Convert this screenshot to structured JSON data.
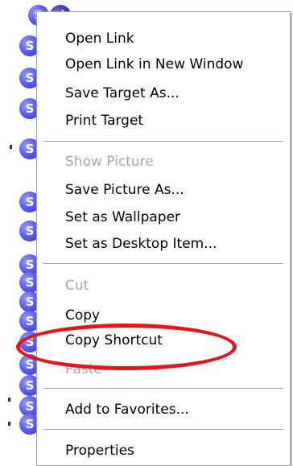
{
  "background": {
    "icons": [
      {
        "letter": "S"
      },
      {
        "letter": "d"
      },
      {
        "letter": "S"
      },
      {
        "letter": "S"
      },
      {
        "letter": "S"
      },
      {
        "letter": "S"
      },
      {
        "letter": "S"
      },
      {
        "letter": "S"
      },
      {
        "letter": "S"
      },
      {
        "letter": "S"
      },
      {
        "letter": "S"
      },
      {
        "letter": "S"
      },
      {
        "letter": "S"
      },
      {
        "letter": "S"
      },
      {
        "letter": "S"
      },
      {
        "letter": "S"
      },
      {
        "letter": "S"
      },
      {
        "letter": "S"
      }
    ]
  },
  "context_menu": {
    "items": [
      {
        "label": "Open Link",
        "enabled": true
      },
      {
        "label": "Open Link in New Window",
        "enabled": true
      },
      {
        "label": "Save Target As...",
        "enabled": true
      },
      {
        "label": "Print Target",
        "enabled": true
      },
      {
        "label": "Show Picture",
        "enabled": false
      },
      {
        "label": "Save Picture As...",
        "enabled": true
      },
      {
        "label": "Set as Wallpaper",
        "enabled": true
      },
      {
        "label": "Set as Desktop Item...",
        "enabled": true
      },
      {
        "label": "Cut",
        "enabled": false
      },
      {
        "label": "Copy",
        "enabled": true
      },
      {
        "label": "Copy Shortcut",
        "enabled": true
      },
      {
        "label": "Paste",
        "enabled": false
      },
      {
        "label": "Add to Favorites...",
        "enabled": true
      },
      {
        "label": "Properties",
        "enabled": true
      }
    ],
    "highlighted_item": "Copy Shortcut"
  },
  "colors": {
    "annotation": "#e8141c",
    "disabled_text": "#a7a6aa",
    "icon_blue": "#5a5ff0"
  }
}
